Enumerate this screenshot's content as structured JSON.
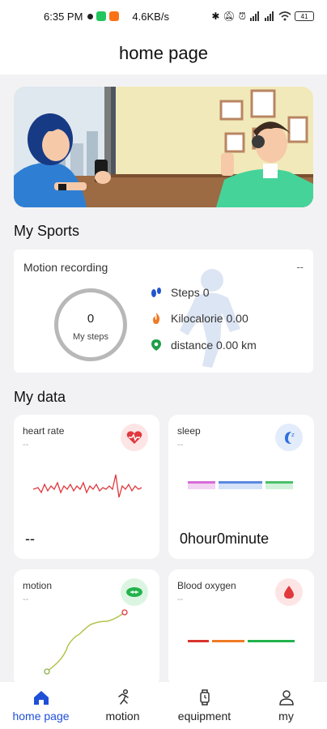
{
  "status_bar": {
    "time": "6:35 PM",
    "speed": "4.6KB/s",
    "battery": "41"
  },
  "header": {
    "title": "home page"
  },
  "sports": {
    "section_title": "My Sports",
    "card_label": "Motion recording",
    "card_value": "--",
    "steps_value": "0",
    "steps_label": "My steps",
    "stats": [
      {
        "label": "Steps 0",
        "icon": "footprint-icon",
        "color": "#2255cc"
      },
      {
        "label": "Kilocalorie 0.00",
        "icon": "flame-icon",
        "color": "#f07a24"
      },
      {
        "label": "distance 0.00 km",
        "icon": "location-pin-icon",
        "color": "#1f9e4a"
      }
    ]
  },
  "data": {
    "section_title": "My data",
    "heart_rate": {
      "title": "heart rate",
      "sub": "--",
      "value": "--",
      "color": "#e0393e"
    },
    "sleep": {
      "title": "sleep",
      "sub": "--",
      "value": "0hour0minute",
      "color": "#2f6fe0"
    },
    "motion": {
      "title": "motion",
      "sub": "--",
      "color": "#22b24c"
    },
    "blood_oxygen": {
      "title": "Blood oxygen",
      "sub": "--",
      "color": "#e0393e"
    }
  },
  "nav": [
    {
      "label": "home page",
      "icon": "home-icon",
      "active": true
    },
    {
      "label": "motion",
      "icon": "running-icon",
      "active": false
    },
    {
      "label": "equipment",
      "icon": "watch-icon",
      "active": false
    },
    {
      "label": "my",
      "icon": "person-icon",
      "active": false
    }
  ]
}
